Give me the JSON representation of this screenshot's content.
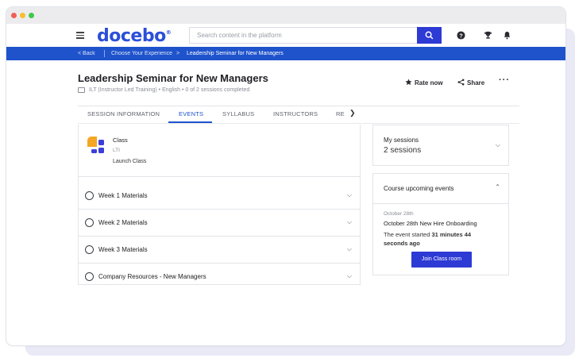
{
  "app": {
    "logo": "docebo",
    "logo_mark": "®",
    "search_placeholder": "Search content in the platform"
  },
  "breadcrumb": {
    "back": "< Back",
    "parent": "Choose Your Experience",
    "arrow": ">",
    "current": "Leadership Seminar for New Managers"
  },
  "course": {
    "title": "Leadership Seminar for New Managers",
    "meta": "ILT (Instructor Led Training) • English • 0 of 2 sessions completed",
    "rate_label": "Rate now",
    "share_label": "Share",
    "more_label": "···"
  },
  "tabs": [
    "SESSION INFORMATION",
    "EVENTS",
    "SYLLABUS",
    "INSTRUCTORS",
    "RE"
  ],
  "tabs_active": "EVENTS",
  "class_item": {
    "name": "Class",
    "type": "LTI",
    "launch": "Launch Class"
  },
  "materials": [
    "Week 1 Materials",
    "Week 2 Materials",
    "Week 3 Materials",
    "Company Resources - New Managers"
  ],
  "sessions": {
    "title": "My sessions",
    "count": "2 sessions"
  },
  "events": {
    "title": "Course upcoming events",
    "date": "October 28th",
    "name": "October 28th New Hire Onboarding",
    "status_prefix": "The event started ",
    "status_bold": "31 minutes 44",
    "status_suffix": "seconds ago",
    "join_label": "Join Class room"
  },
  "colors": {
    "brand_blue": "#1f53cc",
    "button_blue": "#2d3ad4",
    "logo_orange": "#f5a623",
    "logo_indigo": "#3b3fd8"
  }
}
